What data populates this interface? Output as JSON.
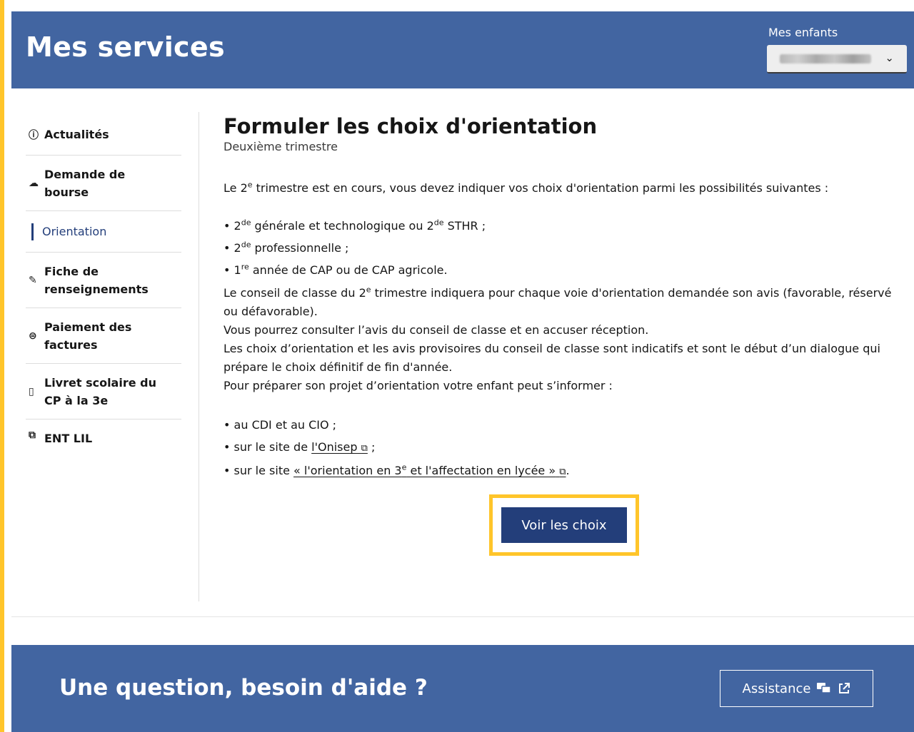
{
  "header": {
    "title": "Mes services",
    "children_label": "Mes enfants",
    "children_select_chevron": "⌄"
  },
  "sidebar": {
    "items": [
      {
        "label": "Actualités",
        "icon": "info-icon",
        "glyph": "ⓘ"
      },
      {
        "label": "Demande de bourse",
        "icon": "hand-coins-icon",
        "glyph": "☁"
      },
      {
        "label": "Orientation",
        "icon": "",
        "glyph": ""
      },
      {
        "label": "Fiche de renseignements",
        "icon": "edit-icon",
        "glyph": "✎"
      },
      {
        "label": "Paiement des factures",
        "icon": "money-icon",
        "glyph": "⊜"
      },
      {
        "label": "Livret scolaire du CP à la 3e",
        "icon": "book-icon",
        "glyph": "▯"
      },
      {
        "label": "ENT LIL",
        "icon": "external-link-icon",
        "glyph": "⧉"
      }
    ]
  },
  "main": {
    "title": "Formuler les choix d'orientation",
    "subtitle": "Deuxième trimestre",
    "intro_a": "Le 2",
    "intro_sup": "e",
    "intro_b": " trimestre est en cours, vous devez indiquer vos choix d'orientation parmi les possibilités suivantes :",
    "options": [
      {
        "a": "2",
        "sup": "de",
        "b": " générale et technologique ou 2",
        "sup2": "de",
        "c": " STHR ;"
      },
      {
        "a": "2",
        "sup": "de",
        "b": " professionnelle ;"
      },
      {
        "a": "1",
        "sup": "re",
        "b": " année de CAP ou de CAP agricole."
      }
    ],
    "council_a": "Le conseil de classe du 2",
    "council_sup": "e",
    "council_b": " trimestre indiquera pour chaque voie d'orientation demandée son avis (favorable, réservé ou défavorable).",
    "consult": "Vous pourrez consulter l’avis du conseil de classe et en accuser réception.",
    "choices": "Les choix d’orientation et les avis provisoires du conseil de classe sont indicatifs et sont le début d’un dialogue qui prépare le choix définitif de fin d'année.",
    "prepare": "Pour préparer son projet d’orientation votre enfant peut s’informer :",
    "info_1": "au CDI et au CIO ;",
    "info_2_pre": "sur le site de ",
    "info_2_link": "l'Onisep",
    "info_2_post": " ;",
    "info_3_pre": "sur le site ",
    "info_3_link_a": "« l'orientation en 3",
    "info_3_link_sup": "e",
    "info_3_link_b": " et l'affectation en lycée »",
    "info_3_post": ".",
    "ext_glyph": "⧉",
    "button": "Voir les choix"
  },
  "footer": {
    "question": "Une question, besoin d'aide ?",
    "assistance": "Assistance"
  },
  "colors": {
    "header_bg": "#4265a1",
    "accent": "#ffc52a",
    "button_bg": "#233e7a",
    "active_nav": "#233e7a"
  }
}
